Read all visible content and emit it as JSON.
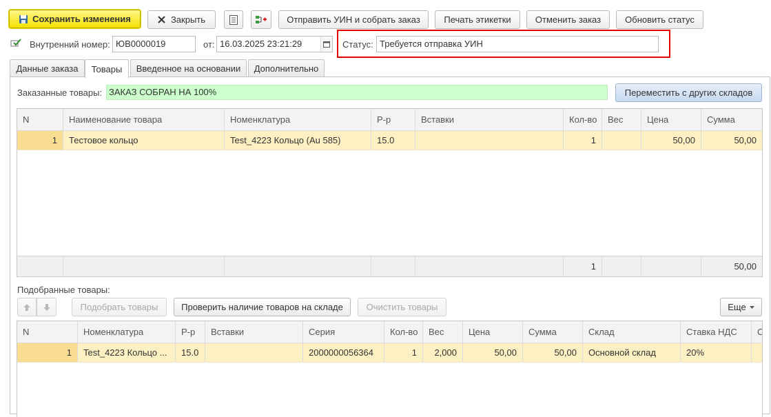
{
  "toolbar": {
    "save_label": "Сохранить изменения",
    "close_label": "Закрыть",
    "send_uin_label": "Отправить УИН и собрать заказ",
    "print_labels_label": "Печать этикетки",
    "cancel_order_label": "Отменить заказ",
    "refresh_status_label": "Обновить статус"
  },
  "header": {
    "internal_number_label": "Внутренний номер:",
    "internal_number_value": "ЮВ0000019",
    "date_label": "от:",
    "date_value": "16.03.2025 23:21:29",
    "status_label": "Статус:",
    "status_value": "Требуется отправка УИН",
    "highlight_color": "#e00000"
  },
  "tabs": [
    {
      "label": "Данные заказа"
    },
    {
      "label": "Товары"
    },
    {
      "label": "Введенное на основании"
    },
    {
      "label": "Дополнительно"
    }
  ],
  "ordered": {
    "label": "Заказанные товары:",
    "status_text": "ЗАКАЗ СОБРАН НА 100%",
    "status_color": "#ccffcc",
    "move_button": "Переместить с других складов",
    "columns": [
      "N",
      "Наименование товара",
      "Номенклатура",
      "Р-р",
      "Вставки",
      "Кол-во",
      "Вес",
      "Цена",
      "Сумма"
    ],
    "rows": [
      {
        "n": "1",
        "name": "Тестовое кольцо",
        "nomenclature": "Test_4223 Кольцо (Au 585)",
        "size": "15.0",
        "inserts": "",
        "qty": "1",
        "weight": "",
        "price": "50,00",
        "sum": "50,00"
      }
    ],
    "totals": {
      "qty": "1",
      "sum": "50,00"
    }
  },
  "picked": {
    "label": "Подобранные товары:",
    "pick_button": "Подобрать товары",
    "check_button": "Проверить наличие товаров на складе",
    "clear_button": "Очистить товары",
    "more_button": "Еще",
    "columns": [
      "N",
      "Номенклатура",
      "Р-р",
      "Вставки",
      "Серия",
      "Кол-во",
      "Вес",
      "Цена",
      "Сумма",
      "Склад",
      "Ставка НДС",
      "С"
    ],
    "rows": [
      {
        "n": "1",
        "nomenclature": "Test_4223 Кольцо ...",
        "size": "15.0",
        "inserts": "",
        "series": "2000000056364",
        "qty": "1",
        "weight": "2,000",
        "price": "50,00",
        "sum": "50,00",
        "warehouse": "Основной склад",
        "vat": "20%"
      }
    ]
  }
}
